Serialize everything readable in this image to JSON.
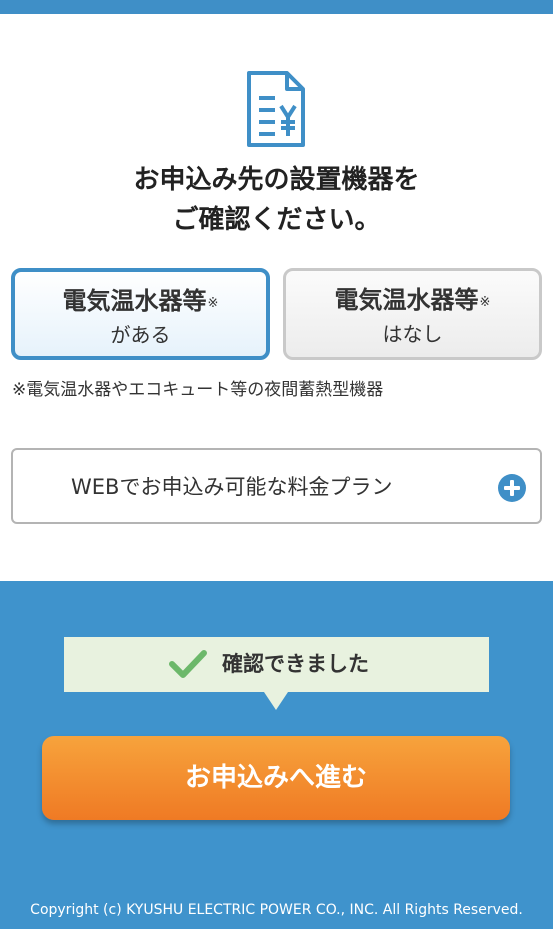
{
  "header": {
    "accent_color": "#3f8fc7"
  },
  "intro": {
    "icon": "document-yen-icon",
    "title_line1": "お申込み先の設置機器を",
    "title_line2": "ご確認ください。"
  },
  "options": [
    {
      "title": "電気温水器等",
      "mark": "※",
      "sub": "がある",
      "selected": true
    },
    {
      "title": "電気温水器等",
      "mark": "※",
      "sub": "はなし",
      "selected": false
    }
  ],
  "note": "※電気温水器やエコキュート等の夜間蓄熱型機器",
  "plans": {
    "label": "WEBでお申込み可能な料金プラン",
    "icon": "plus-circle-icon"
  },
  "confirm": {
    "icon": "checkmark-icon",
    "text": "確認できました"
  },
  "apply_button": {
    "label": "お申込みへ進む"
  },
  "footer": {
    "copyright": "Copyright (c) KYUSHU ELECTRIC POWER CO., INC. All Rights Reserved."
  },
  "colors": {
    "primary_blue": "#3f8fc7",
    "orange": "#ef7a24",
    "confirm_bg": "#e8f2df",
    "check_green": "#6cb86a"
  }
}
